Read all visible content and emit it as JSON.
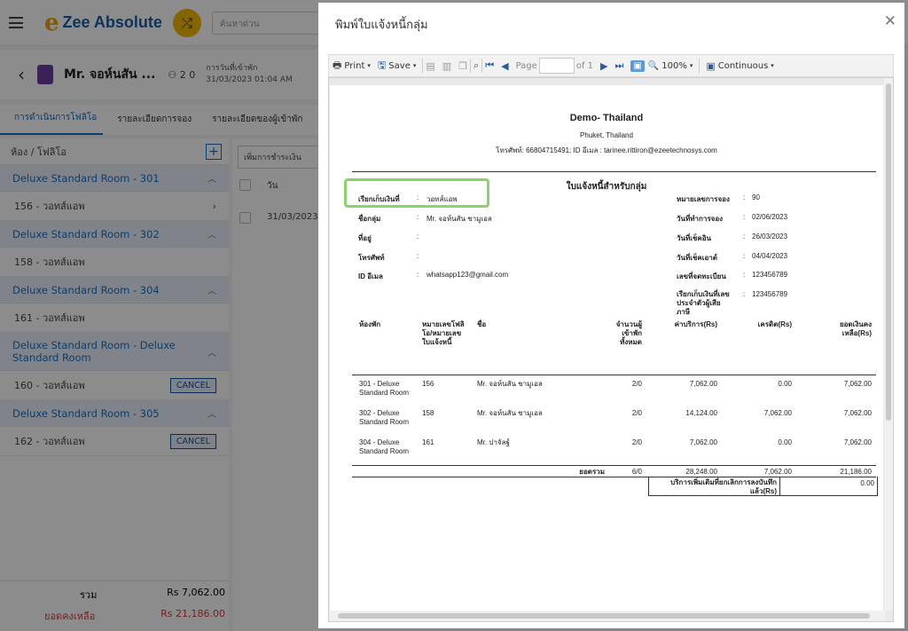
{
  "app": {
    "logo_mark": "e",
    "logo_text": "Zee Absolute",
    "search_placeholder": "ค้นหาด่วน",
    "guest": {
      "name": "Mr. จอห์นสัน ...",
      "pax": "2 0",
      "arrival_label": "การวันที่เข้าพัก",
      "arrival_value": "31/03/2023 01:04 AM"
    },
    "tabs": [
      "การดำเนินการโฟลิโอ",
      "รายละเอียดการจอง",
      "รายละเอียดของผู้เข้าพัก"
    ],
    "panel_title": "ห้อง / โฟลิโอ",
    "rooms": [
      {
        "room": "Deluxe Standard Room - 301",
        "folio": "156 - วอทส์แอพ",
        "cancel": ""
      },
      {
        "room": "Deluxe Standard Room - 302",
        "folio": "158 - วอทส์แอพ",
        "cancel": ""
      },
      {
        "room": "Deluxe Standard Room - 304",
        "folio": "161 - วอทส์แอพ",
        "cancel": ""
      },
      {
        "room": "Deluxe Standard Room - Deluxe Standard Room",
        "folio": "160 - วอทส์แอพ",
        "cancel": "CANCEL"
      },
      {
        "room": "Deluxe Standard Room - 305",
        "folio": "162 - วอทส์แอพ",
        "cancel": "CANCEL"
      }
    ],
    "totals": {
      "total_label": "รวม",
      "total_value": "Rs 7,062.00",
      "balance_label": "ยอดคงเหลือ",
      "balance_value": "Rs 21,186.00"
    },
    "mid": {
      "add_payment": "เพิ่มการชำระเงิน",
      "date_header": "วัน",
      "date_value": "31/03/2023"
    }
  },
  "modal": {
    "title": "พิมพ์ใบแจ้งหนี้กลุ่ม",
    "toolbar": {
      "print": "Print",
      "save": "Save",
      "page_label": "Page",
      "of": "of 1",
      "zoom": "100%",
      "mode": "Continuous"
    }
  },
  "invoice": {
    "company": "Demo- Thailand",
    "city": "Phuket, Thailand",
    "contact": "โทรศัพท์: 66804715491; ID อีเมล : tarinee.rittiron@ezeetechnosys.com",
    "title": "ใบแจ้งหนี้สำหรับกลุ่ม",
    "left_fields": [
      {
        "label": "เรียกเก็บเงินที่",
        "value": "วอทส์แอพ"
      },
      {
        "label": "ชื่อกลุ่ม",
        "value": "Mr. จอห์นสัน ชามูเอล"
      },
      {
        "label": "ที่อยู่",
        "value": ""
      },
      {
        "label": "โทรศัพท์",
        "value": ""
      },
      {
        "label": "ID อีเมล",
        "value": "whatsapp123@gmail.com"
      }
    ],
    "right_fields": [
      {
        "label": "หมายเลขการจอง",
        "value": "90"
      },
      {
        "label": "วันที่ทำการจอง",
        "value": "02/06/2023"
      },
      {
        "label": "วันที่เช็คอิน",
        "value": "26/03/2023"
      },
      {
        "label": "วันที่เช็คเอาต์",
        "value": "04/04/2023"
      },
      {
        "label": "เลขที่จดทะเบียน",
        "value": "123456789"
      },
      {
        "label": "เรียกเก็บเงินที่เลขประจำตัวผู้เสียภาษี",
        "value": "123456789"
      }
    ],
    "columns": [
      "ห้องพัก",
      "หมายเลขโฟลิโอ/หมายเลขใบแจ้งหนี้",
      "ชื่อ",
      "จำนวนผู้เข้าพักทั้งหมด",
      "ค่าบริการ(Rs)",
      "เครดิต(Rs)",
      "ยอดเงินคงเหลือ(Rs)"
    ],
    "rows": [
      {
        "room": "301 - Deluxe Standard Room",
        "folio": "156",
        "name": "Mr. จอห์นสัน ชามูเอล",
        "pax": "2/0",
        "charges": "7,062.00",
        "credit": "0.00",
        "balance": "7,062.00"
      },
      {
        "room": "302 - Deluxe Standard Room",
        "folio": "158",
        "name": "Mr. จอห์นสัน ชามูเอล",
        "pax": "2/0",
        "charges": "14,124.00",
        "credit": "7,062.00",
        "balance": "7,062.00"
      },
      {
        "room": "304 - Deluxe Standard Room",
        "folio": "161",
        "name": "Mr. ปาจัลฐ์",
        "pax": "2/0",
        "charges": "7,062.00",
        "credit": "0.00",
        "balance": "7,062.00"
      }
    ],
    "total": {
      "label": "ยอดรวม",
      "pax": "6/0",
      "charges": "28,248.00",
      "credit": "7,062.00",
      "balance": "21,186.00"
    },
    "extra_service": {
      "label": "บริการเพิ่มเติมที่ยกเลิกการลงบันทึกแล้ว(Rs)",
      "value": "0.00"
    }
  }
}
